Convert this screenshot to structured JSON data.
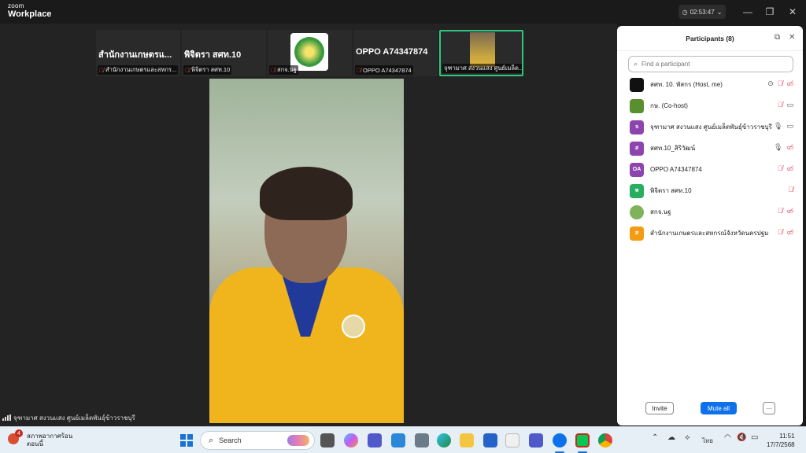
{
  "titlebar": {
    "logo_line1": "zoom",
    "logo_line2": "Workplace",
    "timer": "02:53:47",
    "timer_icon": "clock-icon",
    "controls": [
      "minimize-icon",
      "maximize-icon",
      "close-icon"
    ]
  },
  "strip": {
    "tiles": [
      {
        "big_name": "สำนักงานเกษตรแ...",
        "caption": "สำนักงานเกษตรและสหกร..."
      },
      {
        "big_name": "พิจิตรา สศท.10",
        "caption": "พิจิตรา สศท.10"
      },
      {
        "big_name": "",
        "caption": "สกจ.นฐ"
      },
      {
        "big_name": "OPPO A74347874",
        "caption": "OPPO A74347874"
      },
      {
        "big_name": "",
        "caption": "จุฑามาศ สงวนแสง ศูนย์เมล็ด..."
      }
    ]
  },
  "main_video": {
    "caption": "จุฑามาศ สงวนแสง ศูนย์เมล็ดพันธุ์ข้าวราชบุรี"
  },
  "panel": {
    "title": "Participants (8)",
    "search_placeholder": "Find a participant",
    "participants": [
      {
        "name": "สศท. 10. พัสกร (Host, me)",
        "avatar_text": "",
        "avatar_color": "#111111"
      },
      {
        "name": "กษ. (Co-host)",
        "avatar_text": "",
        "avatar_color": "#5a8f2f"
      },
      {
        "name": "จุฑามาศ สงวนแสง ศูนย์เมล็ดพันธุ์ข้าวราชบุรี",
        "avatar_text": "จ",
        "avatar_color": "#8e44ad"
      },
      {
        "name": "สศท.10_สิริวัฒน์",
        "avatar_text": "ส",
        "avatar_color": "#8e44ad"
      },
      {
        "name": "OPPO A74347874",
        "avatar_text": "OA",
        "avatar_color": "#8e44ad"
      },
      {
        "name": "พิจิตรา สศท.10",
        "avatar_text": "พ",
        "avatar_color": "#27ae60"
      },
      {
        "name": "สกจ.นฐ",
        "avatar_text": "",
        "avatar_color": "#7fb35a"
      },
      {
        "name": "สำนักงานเกษตรและสหกรณ์จังหวัดนครปฐม",
        "avatar_text": "ส",
        "avatar_color": "#f39c12"
      }
    ],
    "invite_label": "Invite",
    "mute_all_label": "Mute all",
    "more_label": "···"
  },
  "taskbar": {
    "weather_line1": "สภาพอากาศร้อน",
    "weather_line2": "ตอนนี้",
    "weather_badge": "4",
    "search_label": "Search",
    "language": "ไทย",
    "time": "11:51",
    "date": "17/7/2568"
  }
}
